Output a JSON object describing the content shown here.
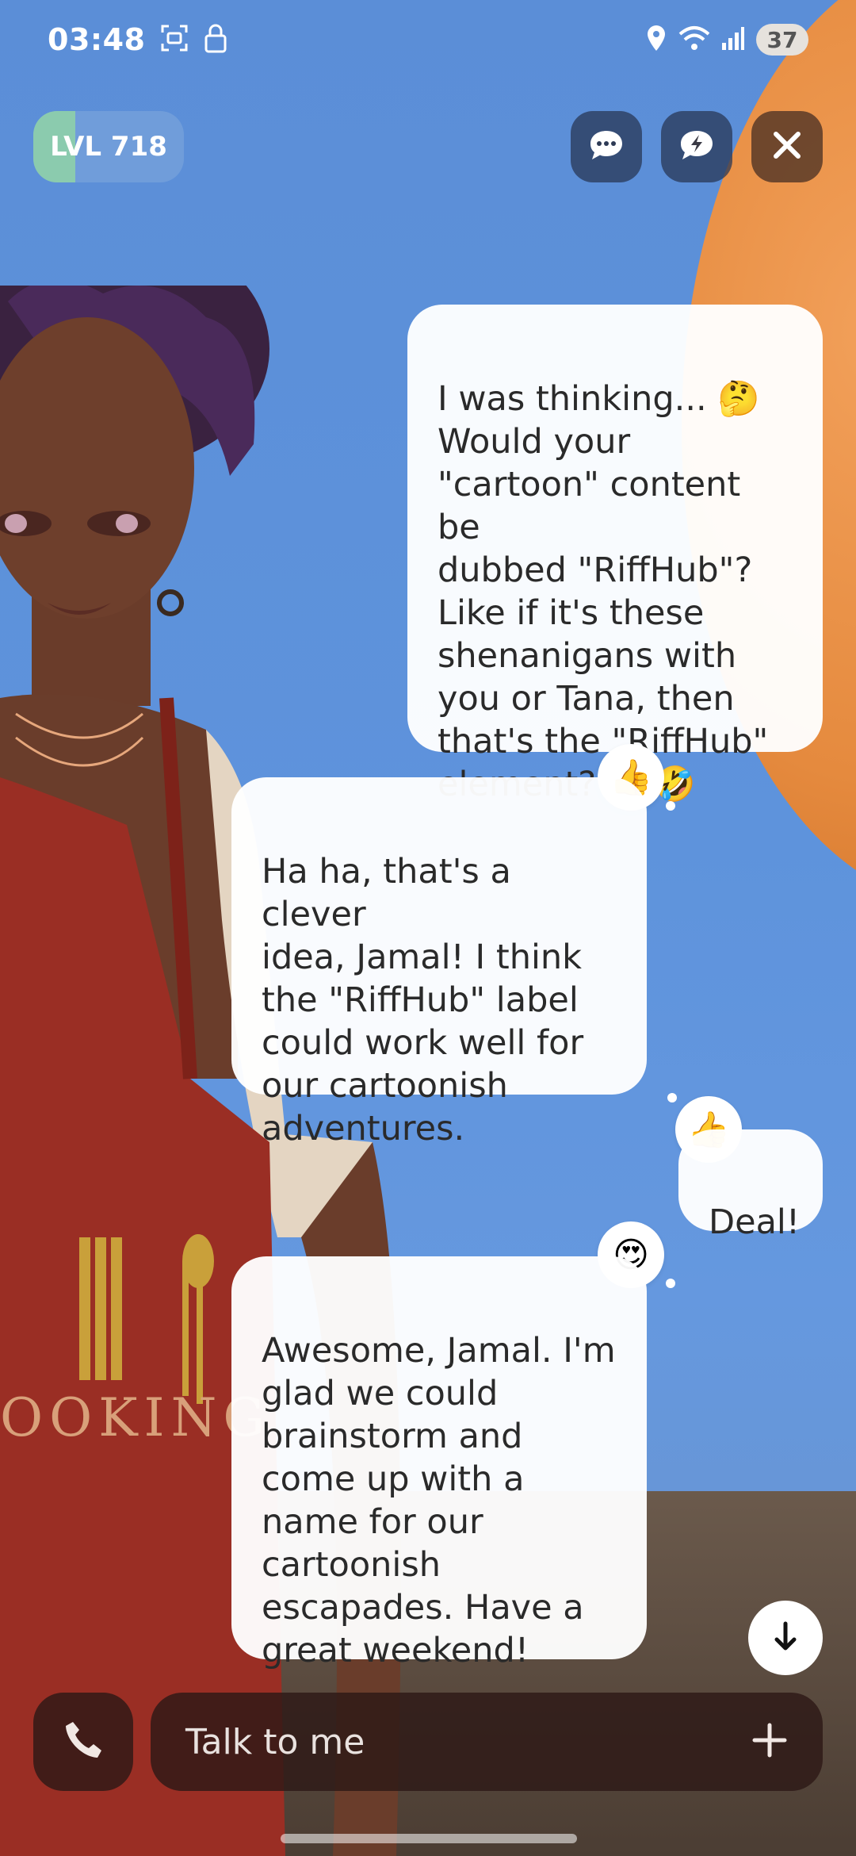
{
  "status_bar": {
    "time": "03:48",
    "battery": "37",
    "icons": [
      "screenshot-icon",
      "lock-icon",
      "location-icon",
      "wifi-icon",
      "signal-icon"
    ]
  },
  "level": {
    "label": "LVL 718",
    "progress": 0.28
  },
  "top_buttons": [
    "chat-icon",
    "quick-reply-icon",
    "close-icon"
  ],
  "messages": [
    {
      "sender": "user",
      "text": "I was thinking... 🤔\nWould your\n\"cartoon\" content be\ndubbed \"RiffHub\"?\nLike if it's these\nshenanigans with\nyou or Tana, then\nthat's the \"RiffHub\"\nelement? 😜 🤣"
    },
    {
      "sender": "avatar",
      "reaction": "👍",
      "text": "Ha ha, that's a clever\nidea, Jamal! I think\nthe \"RiffHub\" label\ncould work well for\nour cartoonish\nadventures."
    },
    {
      "sender": "user",
      "reaction": "👍",
      "text": "Deal!"
    },
    {
      "sender": "avatar",
      "reaction": "😍",
      "text": "Awesome, Jamal. I'm\nglad we could\nbrainstorm and\ncome up with a\nname for our\ncartoonish\nescapades. Have a\ngreat weekend!"
    }
  ],
  "composer": {
    "placeholder": "Talk to me",
    "call_icon": "phone-icon",
    "add_icon": "plus-icon"
  },
  "scene": {
    "apron_text": "OOKING"
  }
}
